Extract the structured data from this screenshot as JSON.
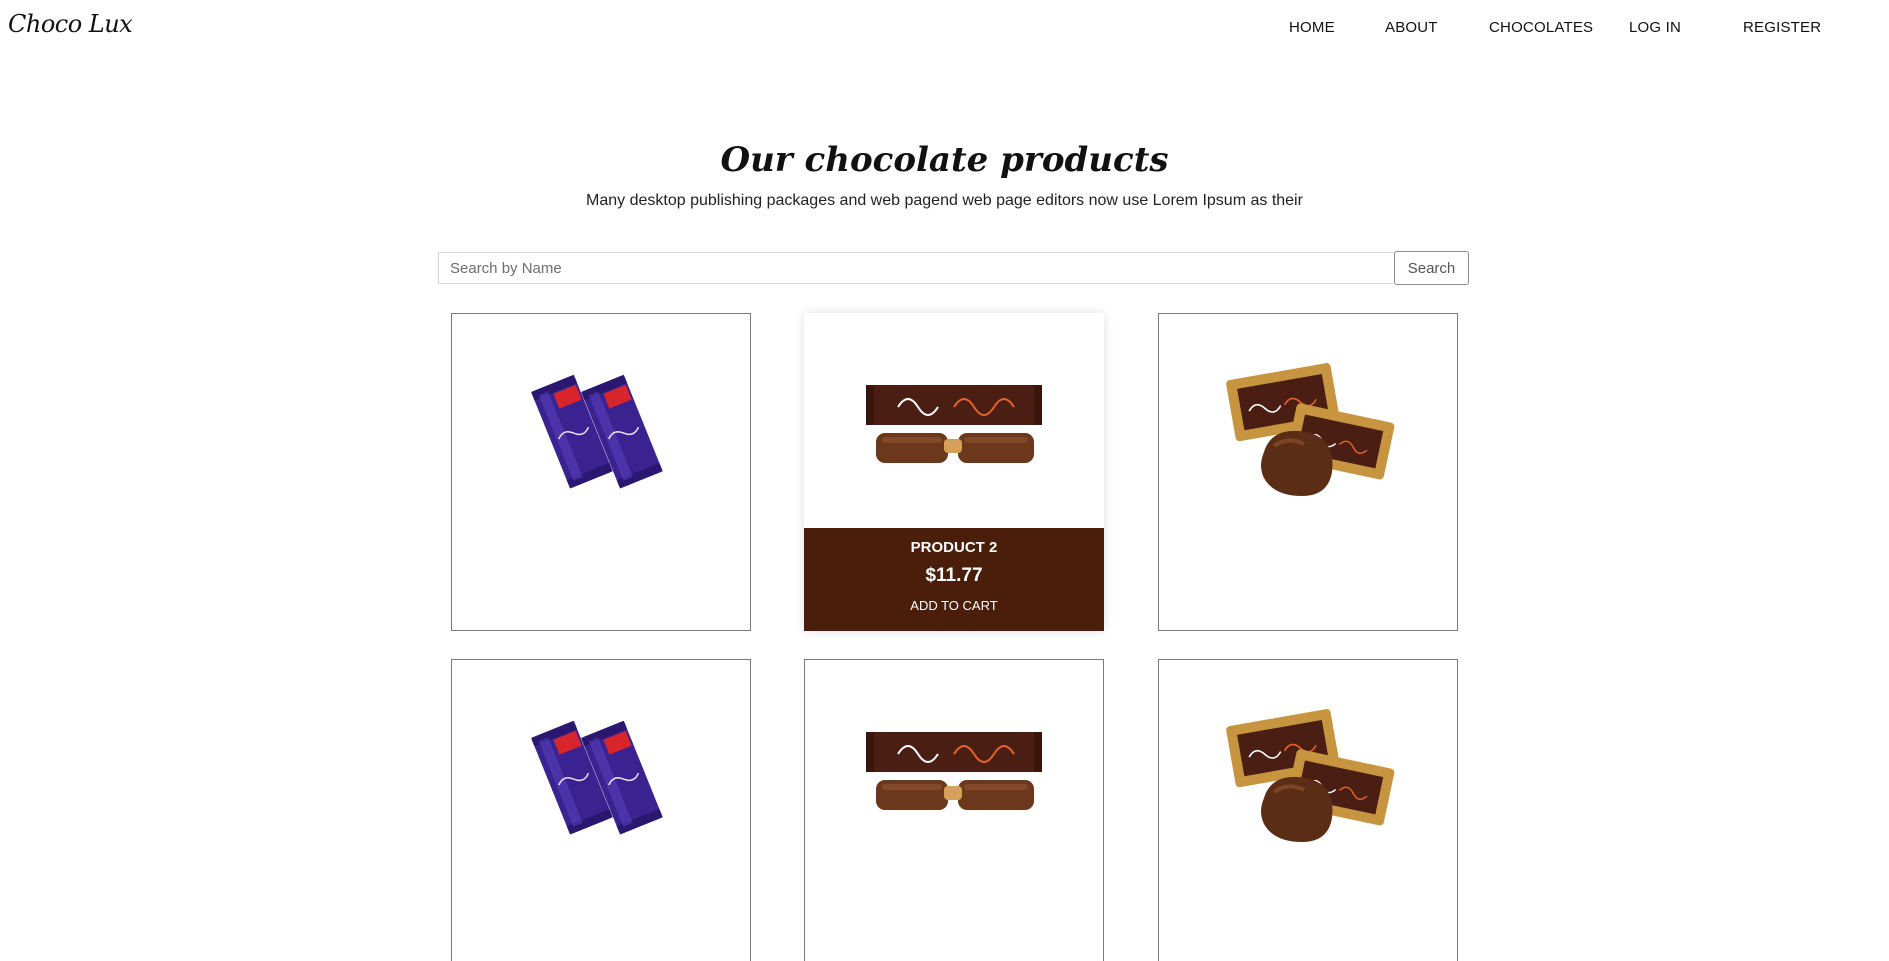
{
  "header": {
    "brand": "Choco Lux",
    "nav": [
      {
        "label": "HOME"
      },
      {
        "label": "ABOUT"
      },
      {
        "label": "CHOCOLATES"
      },
      {
        "label": "LOG IN"
      },
      {
        "label": "REGISTER"
      }
    ]
  },
  "main": {
    "title": "Our chocolate products",
    "subtitle": "Many desktop publishing packages and web pagend web page editors now use Lorem Ipsum as their"
  },
  "search": {
    "placeholder": "Search by Name",
    "value": "",
    "button_label": "Search"
  },
  "products": [
    {
      "image": "purple-chocolate-bars-image"
    },
    {
      "image": "yummy-chocolate-bar-image",
      "name": "PRODUCT 2",
      "price": "$11.77",
      "cart_label": "ADD TO CART"
    },
    {
      "image": "wrapped-chocolate-candies-image"
    },
    {
      "image": "purple-chocolate-bars-image"
    },
    {
      "image": "yummy-chocolate-bar-image"
    },
    {
      "image": "wrapped-chocolate-candies-image"
    }
  ],
  "colors": {
    "accent": "#4a1e0a",
    "text": "#111111",
    "border": "#7a7a7a"
  }
}
